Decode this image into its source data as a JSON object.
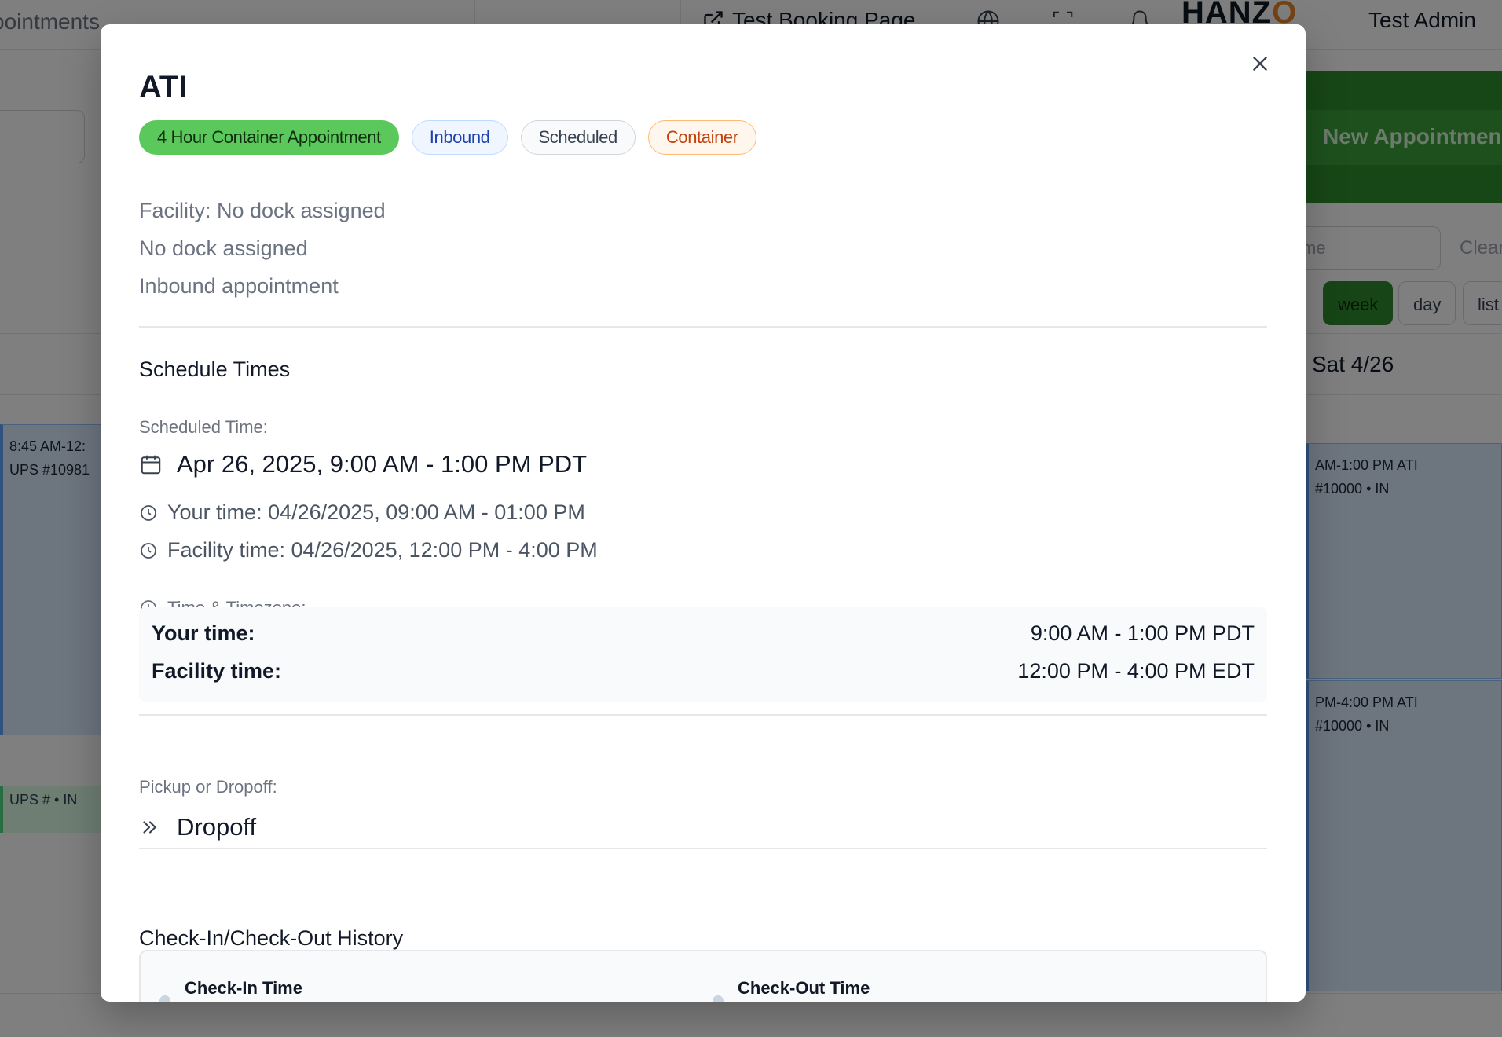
{
  "background": {
    "breadcrumb": "pointments",
    "booking_page_link": "Test Booking Page",
    "logo_text": "HANZ",
    "logo_accent": "O",
    "user_name": "Test Admin",
    "new_appointment_label": "New Appointmen",
    "search_placeholder": "me",
    "clear_label": "Clear",
    "view_buttons": [
      "week",
      "day",
      "list"
    ],
    "day_header": "Sat 4/26",
    "events": [
      {
        "time": "8:45 AM-12:",
        "detail": "UPS #10981"
      },
      {
        "time": "AM-1:00 PM ATI",
        "detail": "#10000 • IN"
      },
      {
        "time": "PM-4:00 PM ATI",
        "detail": "#10000 • IN"
      },
      {
        "time": "UPS # • IN"
      }
    ]
  },
  "modal": {
    "title": "ATI",
    "badges": {
      "type": "4 Hour Container Appointment",
      "direction": "Inbound",
      "status": "Scheduled",
      "category": "Container"
    },
    "facility_line": "Facility: No dock assigned",
    "dock_line": "No dock assigned",
    "direction_line": "Inbound appointment",
    "schedule": {
      "section_title": "Schedule Times",
      "scheduled_label": "Scheduled Time:",
      "scheduled_value": "Apr 26, 2025, 9:00 AM - 1:00 PM PDT",
      "your_time_line": "Your time: 04/26/2025, 09:00 AM - 01:00 PM",
      "facility_time_line": "Facility time: 04/26/2025, 12:00 PM - 4:00 PM",
      "timezone_label": "Time & Timezone:",
      "your_time_key": "Your time:",
      "your_time_value": "9:00 AM - 1:00 PM PDT",
      "facility_time_key": "Facility time:",
      "facility_time_value": "12:00 PM - 4:00 PM EDT"
    },
    "pickup": {
      "label": "Pickup or Dropoff:",
      "value": "Dropoff"
    },
    "history": {
      "section_title": "Check-In/Check-Out History",
      "checkin_label": "Check-In Time",
      "checkout_label": "Check-Out Time"
    }
  },
  "colors": {
    "type_badge": "#5ac85a",
    "inbound_badge_text": "#1e40af",
    "container_badge_text": "#c2410c",
    "brand_green": "#2f8f2f"
  }
}
